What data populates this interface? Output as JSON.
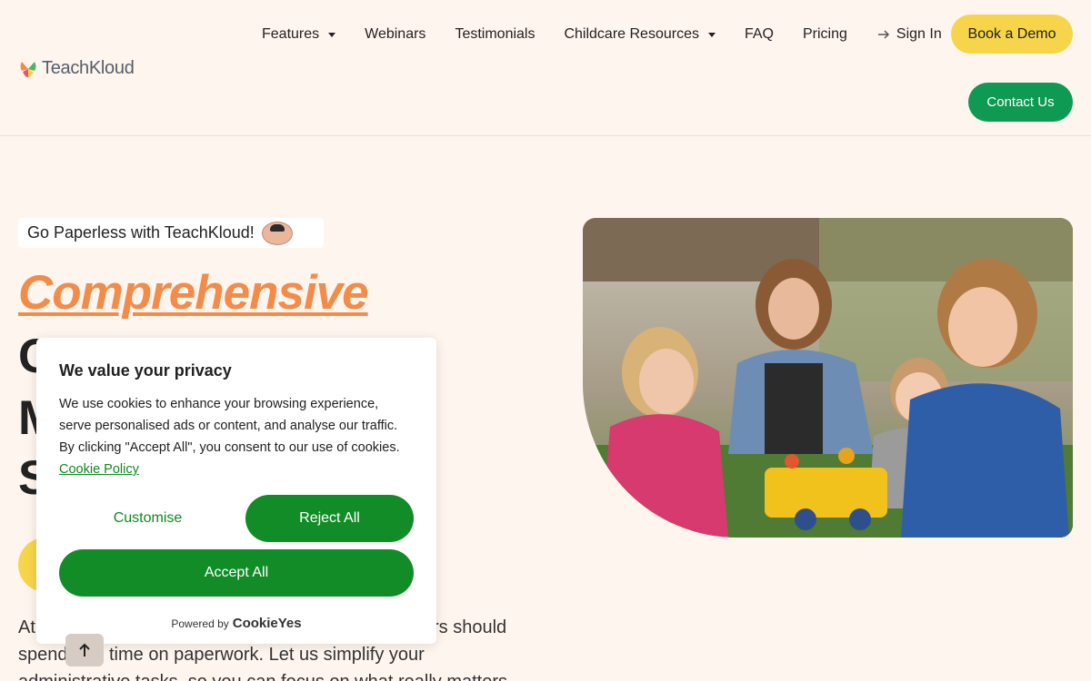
{
  "brand": {
    "name": "TeachKloud"
  },
  "nav": {
    "items": [
      {
        "label": "Features",
        "dropdown": true
      },
      {
        "label": "Webinars",
        "dropdown": false
      },
      {
        "label": "Testimonials",
        "dropdown": false
      },
      {
        "label": "Childcare Resources",
        "dropdown": true
      },
      {
        "label": "FAQ",
        "dropdown": false
      },
      {
        "label": "Pricing",
        "dropdown": false
      }
    ],
    "sign_in": "Sign In",
    "book_demo": "Book a Demo",
    "contact": "Contact Us"
  },
  "hero": {
    "badge": "Go Paperless with TeachKloud!",
    "title_emphasis": "Comprehensive",
    "title_lines": [
      "C",
      "M",
      "S"
    ],
    "paragraph_lines": [
      "At",
      "rs should",
      "spend",
      "time on paperwork. Let us simplify your",
      "administrative tasks, so you can focus on what really matters"
    ]
  },
  "cookie": {
    "title": "We value your privacy",
    "text": "We use cookies to enhance your browsing experience, serve personalised ads or content, and analyse our traffic. By clicking \"Accept All\", you consent to our use of cookies.",
    "policy_link": "Cookie Policy",
    "customise": "Customise",
    "reject": "Reject All",
    "accept": "Accept All",
    "powered_by": "Powered by",
    "powered_brand": "CookieYes"
  },
  "colors": {
    "accent_orange": "#f28c48",
    "accent_yellow": "#f6d54a",
    "brand_green": "#0e9a52",
    "cookie_green": "#128c27",
    "background": "#fff5ef"
  }
}
